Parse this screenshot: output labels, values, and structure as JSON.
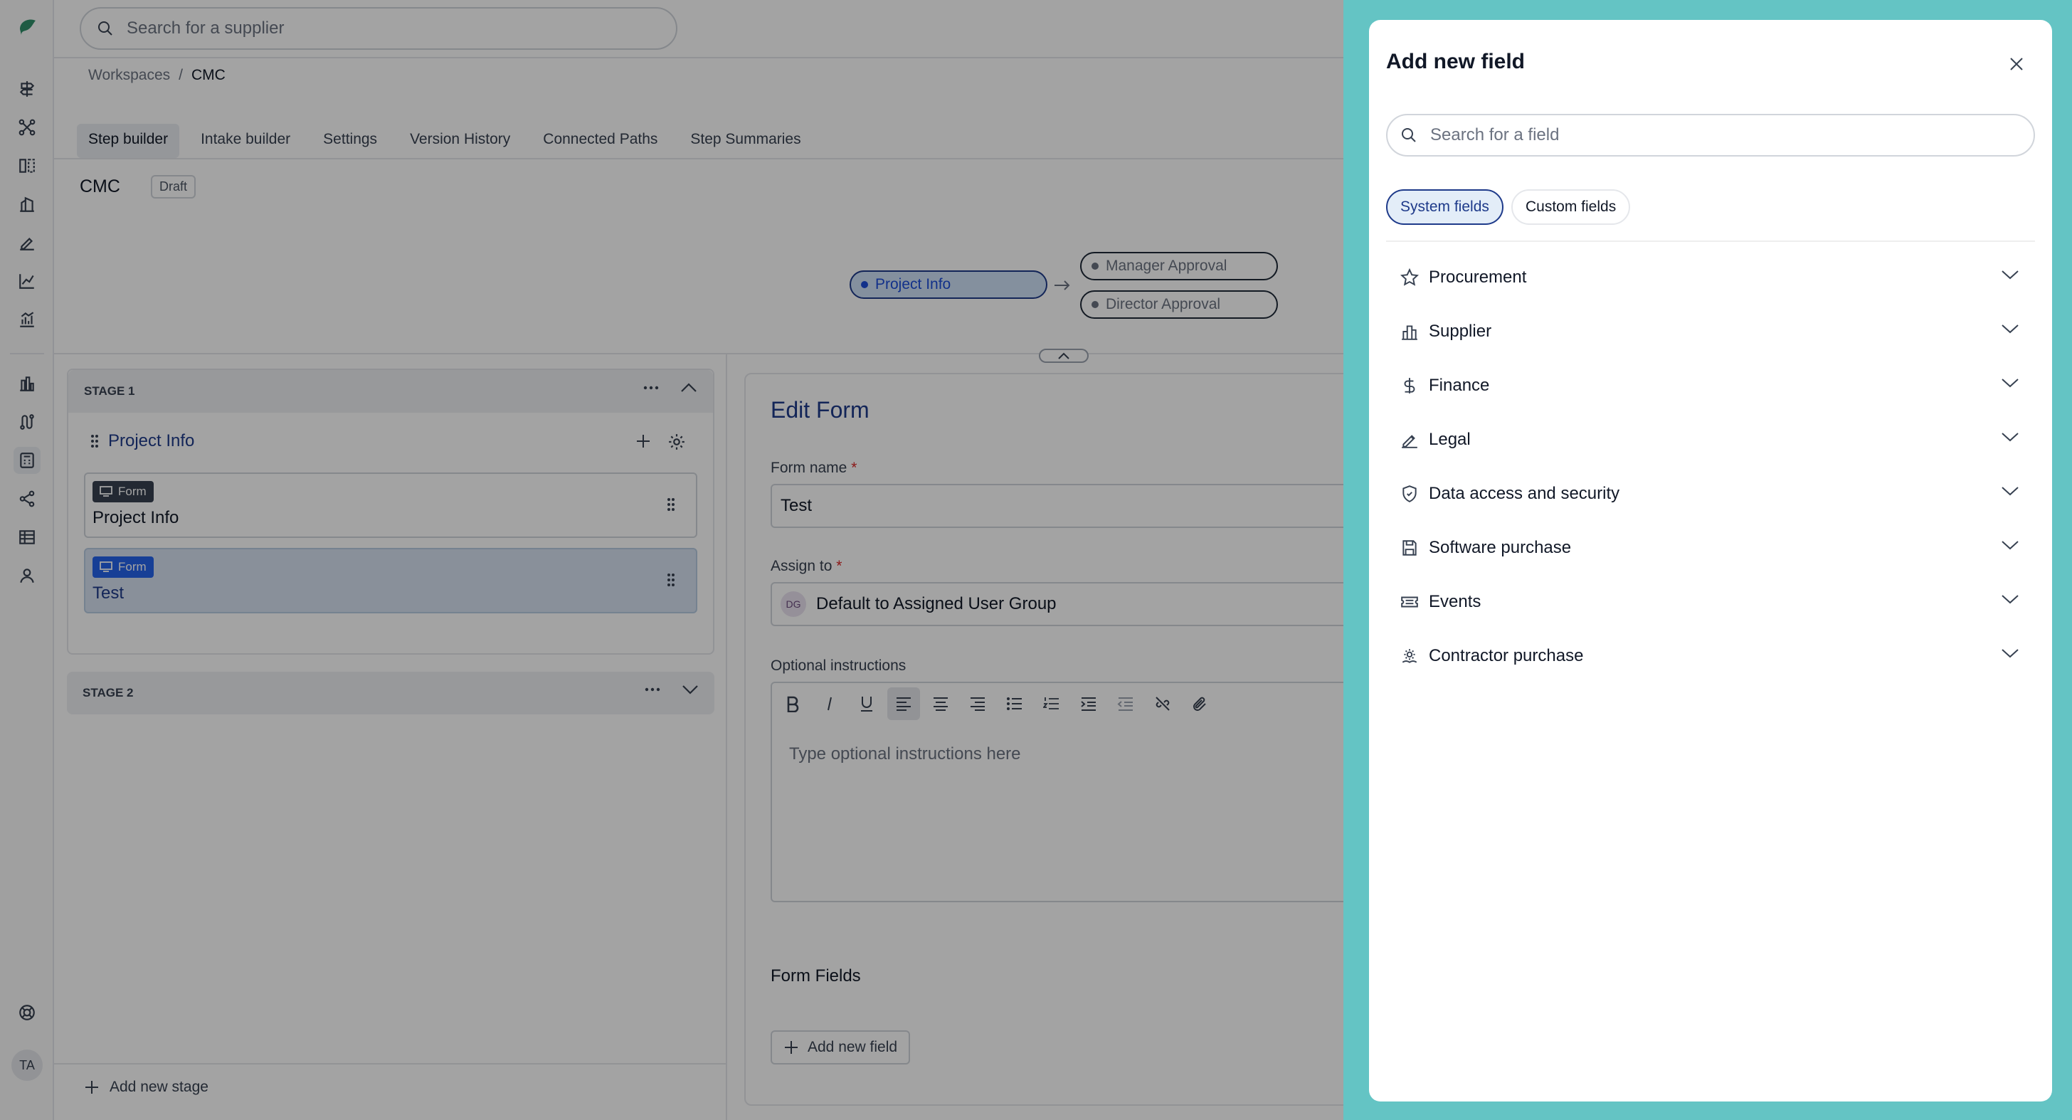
{
  "search": {
    "placeholder": "Search for a supplier"
  },
  "breadcrumb": {
    "root": "Workspaces",
    "sep": "/",
    "current": "CMC"
  },
  "tabs": [
    {
      "label": "Step builder"
    },
    {
      "label": "Intake builder"
    },
    {
      "label": "Settings"
    },
    {
      "label": "Version History"
    },
    {
      "label": "Connected Paths"
    },
    {
      "label": "Step Summaries"
    }
  ],
  "workspace": {
    "title": "CMC",
    "status": "Draft"
  },
  "flow": {
    "nodes": [
      "Project Info",
      "Manager Approval",
      "Director Approval"
    ]
  },
  "stages": [
    {
      "label": "STAGE 1",
      "step_name": "Project Info",
      "forms": [
        {
          "badge": "Form",
          "title": "Project Info"
        },
        {
          "badge": "Form",
          "title": "Test"
        }
      ]
    },
    {
      "label": "STAGE 2"
    }
  ],
  "add_stage_label": "Add new stage",
  "edit_form": {
    "title": "Edit Form",
    "form_name_label": "Form name",
    "form_name_value": "Test",
    "assign_label": "Assign to",
    "assign_initials": "DG",
    "assign_value": "Default to Assigned User Group",
    "instructions_label": "Optional instructions",
    "instructions_placeholder": "Type optional instructions here",
    "form_fields_title": "Form Fields",
    "add_field_label": "Add new field"
  },
  "required_mark": "*",
  "user_initials": "TA",
  "drawer": {
    "title": "Add new field",
    "search_placeholder": "Search for a field",
    "chips": [
      "System fields",
      "Custom fields"
    ],
    "active_chip": "System fields",
    "categories": [
      {
        "label": "Procurement",
        "icon": "star-icon"
      },
      {
        "label": "Supplier",
        "icon": "building-icon"
      },
      {
        "label": "Finance",
        "icon": "dollar-icon"
      },
      {
        "label": "Legal",
        "icon": "signature-icon"
      },
      {
        "label": "Data access and security",
        "icon": "shield-icon"
      },
      {
        "label": "Software purchase",
        "icon": "save-disk-icon"
      },
      {
        "label": "Events",
        "icon": "ticket-icon"
      },
      {
        "label": "Contractor purchase",
        "icon": "gear-hands-icon"
      }
    ]
  },
  "colors": {
    "accent": "#1e3a8a",
    "drawer_frame": "#64c4c4",
    "active_pill": "#cfe1f7",
    "form_badge_active": "#2563eb"
  }
}
